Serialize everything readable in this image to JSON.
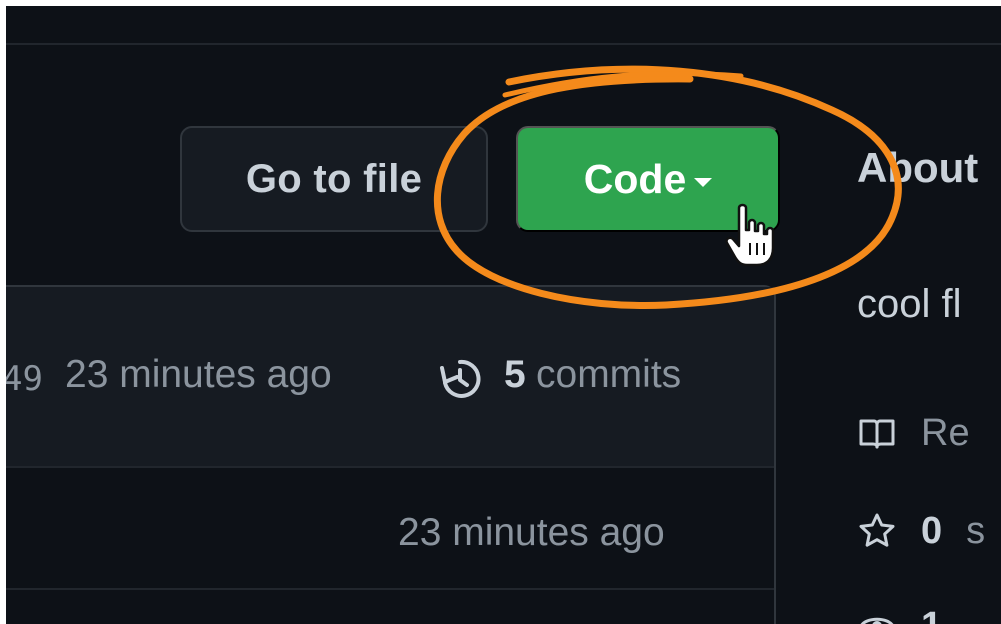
{
  "header": {
    "goto_file_label": "Go to file",
    "code_label": "Code"
  },
  "commit": {
    "hash_fragment": "49",
    "time": "23 minutes ago",
    "count": "5",
    "count_label": "commits"
  },
  "files": [
    {
      "time": "23 minutes ago"
    }
  ],
  "about": {
    "title": "About",
    "description": "cool fl",
    "readme_label": "Re",
    "stars_count": "0",
    "stars_label": "s",
    "watch_count": "1"
  },
  "colors": {
    "background": "#0d1117",
    "code_button": "#2ea44f",
    "annotation_circle": "#f48a1b",
    "text": "#c9d1d9",
    "muted_text": "#8b949e"
  },
  "icons": {
    "caret": "caret-down-icon",
    "history": "history-icon",
    "book": "book-icon",
    "star": "star-icon",
    "eye": "eye-icon",
    "cursor": "hand-pointer-icon"
  }
}
